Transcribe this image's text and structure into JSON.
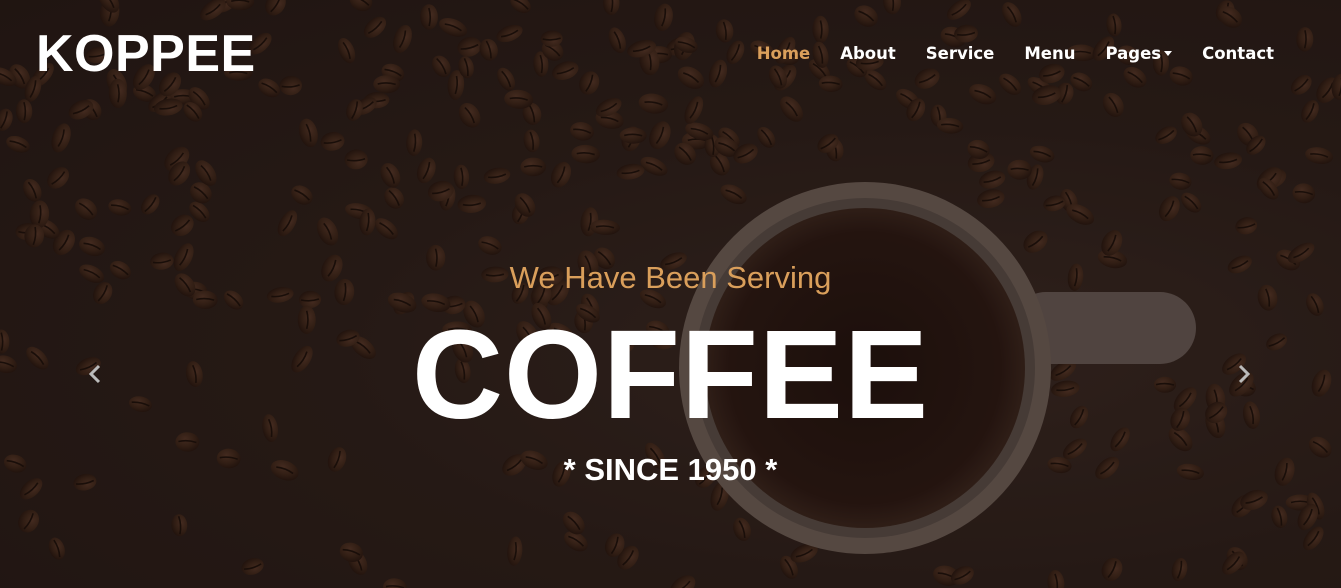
{
  "brand": {
    "name": "KOPPEE"
  },
  "nav": {
    "items": [
      {
        "label": "Home",
        "active": true,
        "dropdown": false
      },
      {
        "label": "About",
        "active": false,
        "dropdown": false
      },
      {
        "label": "Service",
        "active": false,
        "dropdown": false
      },
      {
        "label": "Menu",
        "active": false,
        "dropdown": false
      },
      {
        "label": "Pages",
        "active": false,
        "dropdown": true
      },
      {
        "label": "Contact",
        "active": false,
        "dropdown": false
      }
    ]
  },
  "hero": {
    "subtitle": "We Have Been Serving",
    "title": "COFFEE",
    "tagline": "* SINCE 1950 *",
    "controls": {
      "prev_icon": "chevron-left-icon",
      "next_icon": "chevron-right-icon"
    }
  },
  "colors": {
    "accent": "#da9f5b",
    "text": "#ffffff",
    "background": "#2a1d18"
  }
}
